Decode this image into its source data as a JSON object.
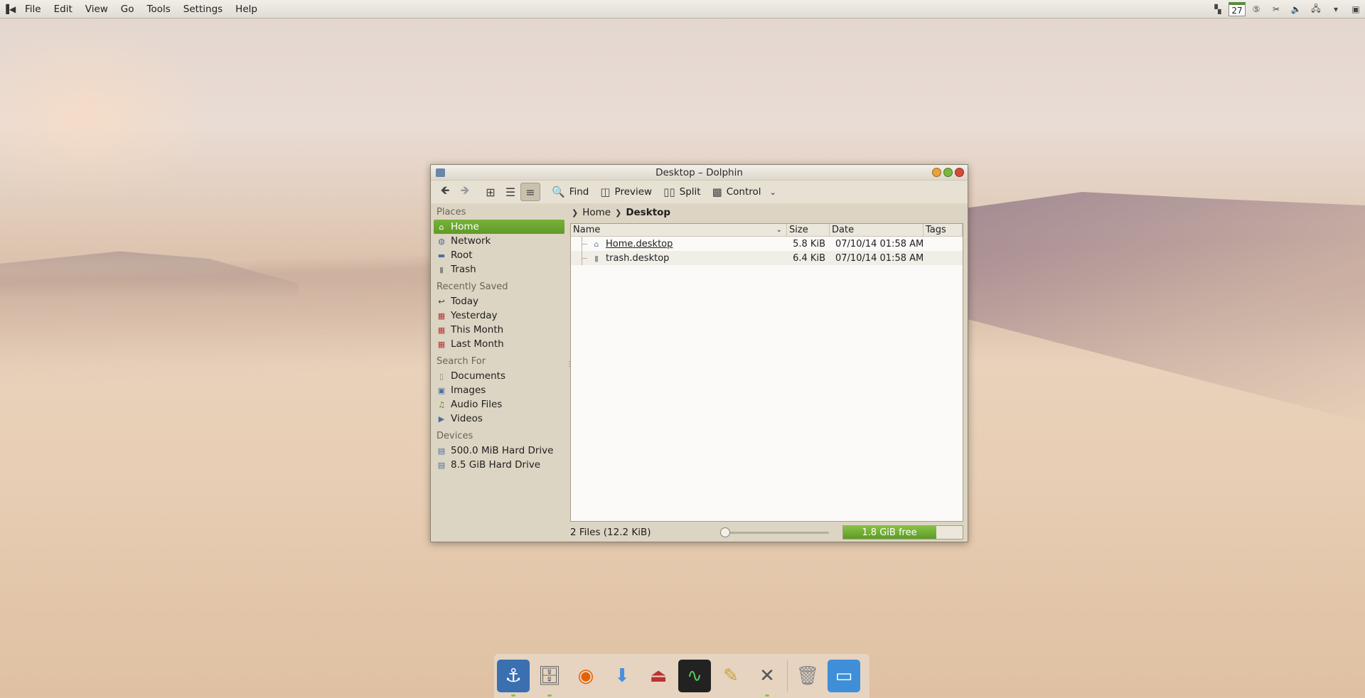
{
  "menubar": {
    "items": [
      {
        "label": "File"
      },
      {
        "label": "Edit"
      },
      {
        "label": "View"
      },
      {
        "label": "Go"
      },
      {
        "label": "Tools"
      },
      {
        "label": "Settings"
      },
      {
        "label": "Help"
      }
    ],
    "tray": {
      "date": "27",
      "icons": [
        "desktop-pager-icon",
        "calendar-icon",
        "klipper-icon",
        "scissors-icon",
        "volume-icon",
        "network-icon",
        "tray-expand-icon",
        "device-icon"
      ]
    }
  },
  "window": {
    "title": "Desktop – Dolphin",
    "toolbar": {
      "find_label": "Find",
      "preview_label": "Preview",
      "split_label": "Split",
      "control_label": "Control"
    },
    "places": {
      "groups": [
        {
          "label": "Places",
          "items": [
            {
              "label": "Home",
              "icon": "home-folder-icon",
              "selected": true
            },
            {
              "label": "Network",
              "icon": "network-icon"
            },
            {
              "label": "Root",
              "icon": "folder-icon"
            },
            {
              "label": "Trash",
              "icon": "trash-icon"
            }
          ]
        },
        {
          "label": "Recently Saved",
          "items": [
            {
              "label": "Today",
              "icon": "clock-icon"
            },
            {
              "label": "Yesterday",
              "icon": "calendar-icon"
            },
            {
              "label": "This Month",
              "icon": "calendar-icon"
            },
            {
              "label": "Last Month",
              "icon": "calendar-icon"
            }
          ]
        },
        {
          "label": "Search For",
          "items": [
            {
              "label": "Documents",
              "icon": "document-icon"
            },
            {
              "label": "Images",
              "icon": "image-icon"
            },
            {
              "label": "Audio Files",
              "icon": "music-icon"
            },
            {
              "label": "Videos",
              "icon": "video-icon"
            }
          ]
        },
        {
          "label": "Devices",
          "items": [
            {
              "label": "500.0 MiB Hard Drive",
              "icon": "hard-drive-icon"
            },
            {
              "label": "8.5 GiB Hard Drive",
              "icon": "hard-drive-icon"
            }
          ]
        }
      ]
    },
    "breadcrumb": {
      "home": "Home",
      "current": "Desktop"
    },
    "columns": {
      "name": "Name",
      "size": "Size",
      "date": "Date",
      "tags": "Tags"
    },
    "files": [
      {
        "name": "Home.desktop",
        "size": "5.8 KiB",
        "date": "07/10/14 01:58 AM",
        "icon": "home-folder-icon"
      },
      {
        "name": "trash.desktop",
        "size": "6.4 KiB",
        "date": "07/10/14 01:58 AM",
        "icon": "trash-icon"
      }
    ],
    "status": {
      "summary": "2 Files (12.2 KiB)",
      "free_space": "1.8 GiB free",
      "used_fraction": 0.78,
      "zoom_fraction": 0.02
    }
  },
  "dock": {
    "items": [
      {
        "icon": "anchor-icon",
        "running": true
      },
      {
        "icon": "file-manager-icon",
        "running": true
      },
      {
        "icon": "firefox-icon",
        "running": false
      },
      {
        "icon": "download-icon",
        "running": false
      },
      {
        "icon": "installer-icon",
        "running": false
      },
      {
        "icon": "system-monitor-icon",
        "running": false
      },
      {
        "icon": "text-editor-icon",
        "running": false
      },
      {
        "icon": "settings-tools-icon",
        "running": true
      },
      {
        "icon": "trash-icon",
        "running": false
      },
      {
        "icon": "show-desktop-icon",
        "running": false
      }
    ]
  },
  "colors": {
    "accent": "#6aa92f",
    "window_bg": "#ddd5c3"
  }
}
